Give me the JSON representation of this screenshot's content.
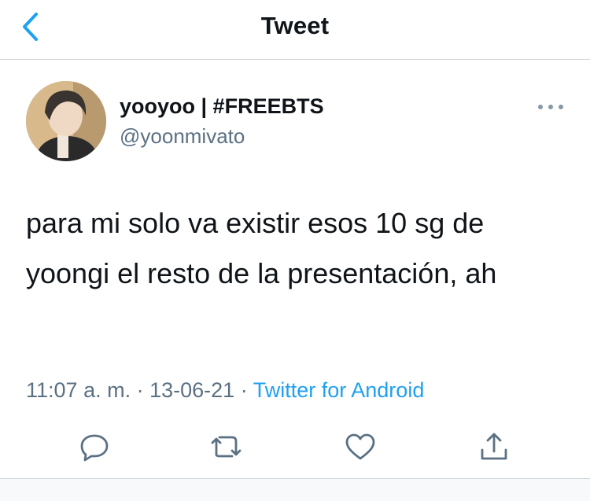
{
  "header": {
    "title": "Tweet",
    "back_icon": "chevron-left-icon"
  },
  "author": {
    "display_name": "yooyoo | #FREEBTS",
    "handle": "@yoonmivato"
  },
  "tweet": {
    "text": "para mi solo va existir esos 10 sg de yoongi el resto de la presentación, ah",
    "time": "11:07 a. m.",
    "separator": "·",
    "date": "13-06-21",
    "source": "Twitter for Android"
  },
  "actions": {
    "reply_icon": "reply-icon",
    "retweet_icon": "retweet-icon",
    "like_icon": "heart-icon",
    "share_icon": "share-icon",
    "more_icon": "more-horizontal-icon"
  },
  "colors": {
    "accent": "#1da1f2",
    "secondary_text": "#5b7083",
    "primary_text": "#0f1419",
    "divider": "#cfd6dc"
  }
}
